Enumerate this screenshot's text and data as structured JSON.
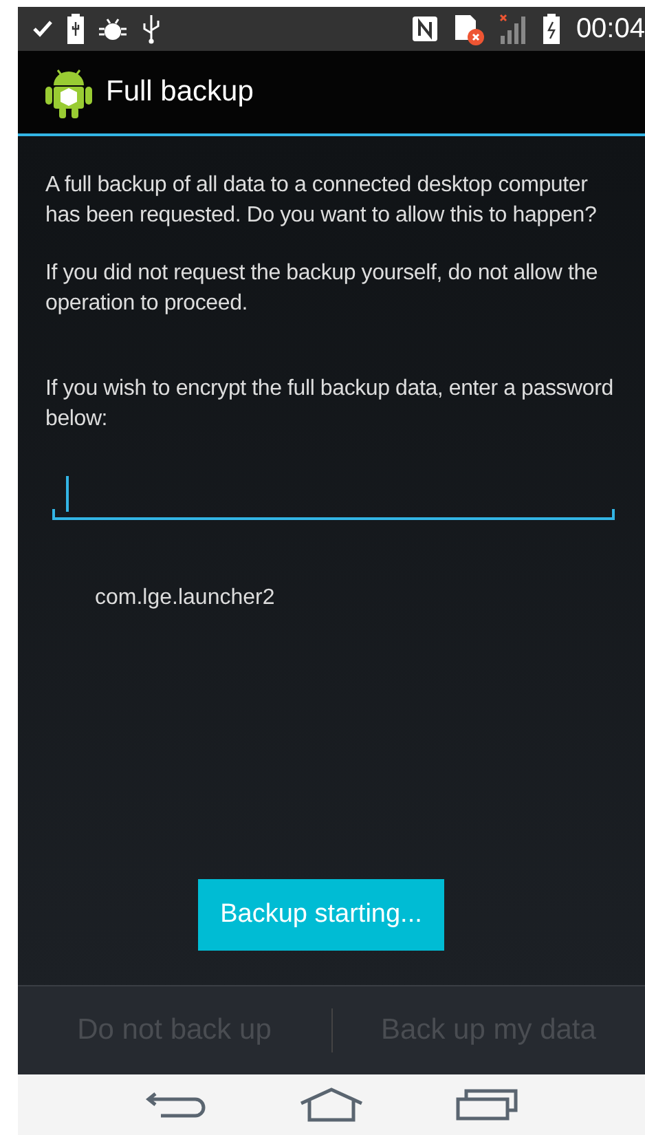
{
  "status_bar": {
    "time": "00:04"
  },
  "title_bar": {
    "title": "Full backup"
  },
  "paragraphs": [
    "A full backup of all data to a connected desktop computer has been requested.  Do you want to allow this to happen?",
    "If you did not request the backup yourself, do not allow the operation to proceed.",
    "If you wish to encrypt the full backup data, enter a password below:"
  ],
  "password_field": {
    "focused": true
  },
  "package": "com.lge.launcher2",
  "toast": "Backup starting...",
  "buttons": [
    {
      "label": "Do not back up",
      "disabled": true
    },
    {
      "label": "Back up my data",
      "disabled": true
    }
  ]
}
